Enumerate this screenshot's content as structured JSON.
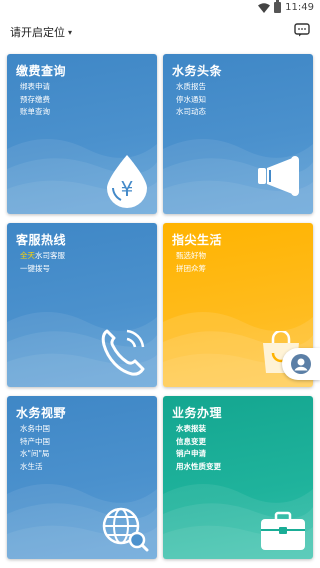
{
  "status_bar": {
    "time": "11:49"
  },
  "header": {
    "location_label": "请开启定位",
    "chevron": "▾",
    "message_icon": "chat-bubble-icon"
  },
  "cards": {
    "payment": {
      "title": "缴费查询",
      "items": [
        "绑表申请",
        "预存缴费",
        "账单查询"
      ],
      "icon": "yuan-water-drop-icon"
    },
    "news": {
      "title": "水务头条",
      "items": [
        "水质报告",
        "停水通知",
        "水司动态"
      ],
      "icon": "megaphone-icon"
    },
    "hotline": {
      "title": "客服热线",
      "items_highlight": "全天",
      "items_first_rest": "水司客服",
      "items": [
        "一键拨号"
      ],
      "icon": "phone-icon"
    },
    "life": {
      "title": "指尖生活",
      "items": [
        "甄选好物",
        "拼团众筹"
      ],
      "icon": "shopping-bag-icon"
    },
    "vision": {
      "title": "水务视野",
      "items": [
        "水务中国",
        "特产中国",
        "水\"间\"局",
        "水生活"
      ],
      "icon": "globe-search-icon"
    },
    "business": {
      "title": "业务办理",
      "items": [
        "水表报装",
        "信息变更",
        "销户申请",
        "用水性质变更"
      ],
      "icon": "briefcase-icon"
    }
  },
  "colors": {
    "blue": "#4389c8",
    "yellow": "#ffb800",
    "green": "#1aad96"
  }
}
